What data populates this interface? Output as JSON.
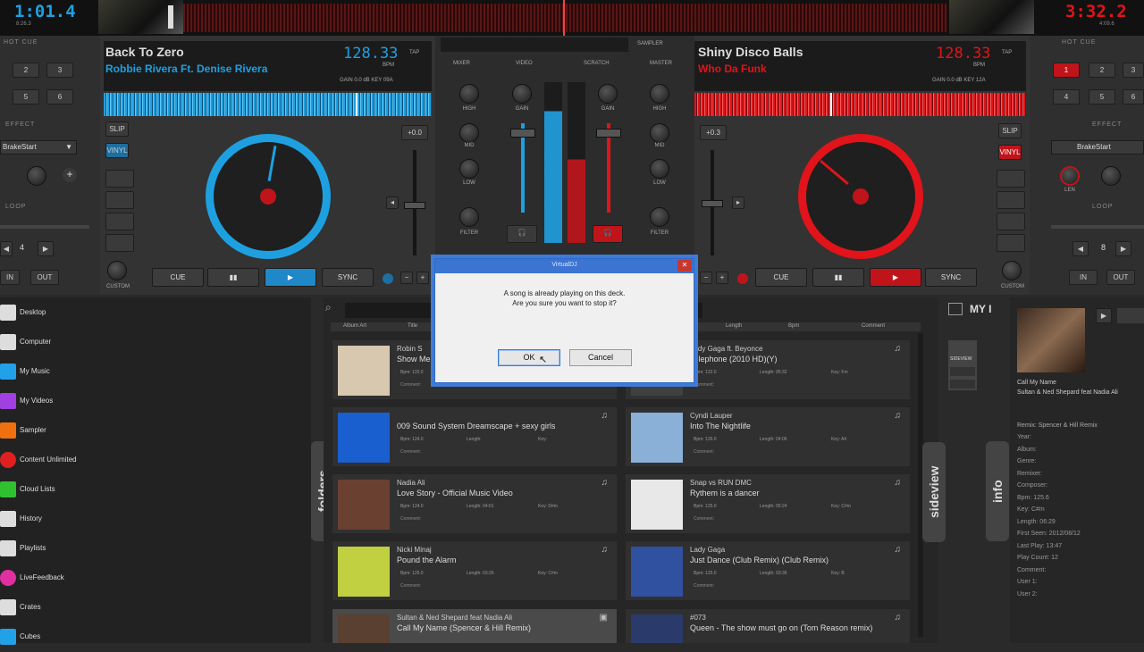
{
  "top": {
    "left_time": "1:01.4",
    "left_sub": "8:26.3",
    "right_time": "3:32.2",
    "right_sub": "4:09.6"
  },
  "left_panel": {
    "hot_cue_label": "HOT CUE",
    "hot_cues": [
      "2",
      "3",
      "5",
      "6"
    ],
    "effect_label": "EFFECT",
    "effect_name": "BrakeStart",
    "loop_label": "LOOP",
    "loop_value": "4",
    "in_label": "IN",
    "out_label": "OUT",
    "custom_label": "CUSTOM"
  },
  "right_panel": {
    "hot_cue_label": "HOT CUE",
    "hot_cues": [
      "1",
      "2",
      "3",
      "4",
      "5",
      "6"
    ],
    "effect_label": "EFFECT",
    "effect_name": "BrakeStart",
    "len_label": "LEN",
    "loop_label": "LOOP",
    "loop_value": "8",
    "in_label": "IN",
    "out_label": "OUT",
    "custom_label": "CUSTOM"
  },
  "deck_left": {
    "title": "Back To Zero",
    "artist": "Robbie Rivera Ft. Denise Rivera",
    "bpm": "128.33",
    "bpm_unit": "BPM",
    "tap": "TAP",
    "gain_row": "GAIN  0.0 dB  KEY  09A",
    "slip": "SLIP",
    "vinyl": "VINYL",
    "pitch": "+0.0",
    "cue": "CUE",
    "sync": "SYNC",
    "accent": "#1ea0e0"
  },
  "deck_right": {
    "title": "Shiny Disco Balls",
    "artist": "Who Da Funk",
    "bpm": "128.33",
    "bpm_unit": "BPM",
    "tap": "TAP",
    "gain_row": "GAIN  0.0 dB  KEY  12A",
    "slip": "SLIP",
    "vinyl": "VINYL",
    "pitch": "+0.3",
    "cue": "CUE",
    "sync": "SYNC",
    "accent": "#e0141a"
  },
  "mixer": {
    "tabs": [
      "MIXER",
      "VIDEO",
      "SCRATCH",
      "MASTER"
    ],
    "sampler": "SAMPLER",
    "high": "HIGH",
    "mid": "MID",
    "low": "LOW",
    "filter": "FILTER",
    "gain": "GAIN"
  },
  "folders": [
    {
      "label": "Desktop",
      "color": "#dddddd"
    },
    {
      "label": "Computer",
      "color": "#dddddd"
    },
    {
      "label": "My Music",
      "color": "#22a0e8"
    },
    {
      "label": "My Videos",
      "color": "#a040e0"
    },
    {
      "label": "Sampler",
      "color": "#f07010"
    },
    {
      "label": "Content Unlimited",
      "color": "#e02020"
    },
    {
      "label": "Cloud Lists",
      "color": "#30c030"
    },
    {
      "label": "History",
      "color": "#dddddd"
    },
    {
      "label": "Playlists",
      "color": "#dddddd"
    },
    {
      "label": "LiveFeedback",
      "color": "#e030a0"
    },
    {
      "label": "Crates",
      "color": "#dddddd"
    },
    {
      "label": "Cubes",
      "color": "#22a0e8"
    }
  ],
  "browser": {
    "columns_left": [
      "Album Art",
      "Title"
    ],
    "columns_right": [
      "Length",
      "Bpm",
      "Comment"
    ],
    "folders_tab": "folders",
    "sideview_tab": "sideview",
    "info_tab": "info",
    "my_label": "MY I",
    "sideview_btn": "SIDEVIEW",
    "tracks_left": [
      {
        "artist": "Robin S",
        "title": "Show Me Love",
        "bpm": "Bpm: 120.0",
        "length": "",
        "key": "",
        "color": "#d8c8b0"
      },
      {
        "artist": "009 Sound System Dreamscape + sexy girls",
        "title": "",
        "bpm": "Bpm: 124.0",
        "length": "Length:",
        "key": "Key:",
        "color": "#1a5fd0"
      },
      {
        "artist": "Nadia Ali",
        "title": "Love Story - Official Music Video",
        "bpm": "Bpm: 124.0",
        "length": "Length: 04:01",
        "key": "Key: D#m",
        "color": "#6a4030"
      },
      {
        "artist": "Nicki Minaj",
        "title": "Pound the Alarm",
        "bpm": "Bpm: 125.0",
        "length": "Length: 03:26",
        "key": "Key: C#m",
        "color": "#c0d040"
      },
      {
        "artist": "Sultan & Ned Shepard feat Nadia Ali",
        "title": "Call My Name (Spencer & Hill Remix)",
        "bpm": "",
        "length": "",
        "key": "",
        "color": "#5a4030"
      }
    ],
    "tracks_right": [
      {
        "artist": "Lady Gaga ft. Beyonce",
        "title": "Telephone (2010 HD)(Y)",
        "bpm": "Bpm: 122.0",
        "length": "Length: 05:32",
        "key": "Key: Fm",
        "color": "#404040"
      },
      {
        "artist": "Cyndi Lauper",
        "title": "Into The Nightlife",
        "bpm": "Bpm: 126.0",
        "length": "Length: 04:06",
        "key": "Key: A#",
        "color": "#8ab0d8"
      },
      {
        "artist": "Snap vs RUN DMC",
        "title": "Rythem is a dancer",
        "bpm": "Bpm: 125.0",
        "length": "Length: 05:24",
        "key": "Key: C#m",
        "color": "#e8e8e8"
      },
      {
        "artist": "Lady Gaga",
        "title": "Just Dance (Club Remix) (Club Remix)",
        "bpm": "Bpm: 125.0",
        "length": "Length: 03:36",
        "key": "Key: B",
        "color": "#3050a0"
      },
      {
        "artist": "#073",
        "title": "Queen - The show must go on (Tom Reason remix)",
        "bpm": "",
        "length": "",
        "key": "",
        "color": "#2a3a6a"
      }
    ],
    "comment": "Comment:"
  },
  "info": {
    "name": "Call My Name",
    "artist": "Sultan & Ned Shepard feat Nadia Ali",
    "remix": "Remix: Spencer & Hill Remix",
    "fields": [
      "Year:",
      "Album:",
      "Genre:",
      "Remixer:",
      "Composer:",
      "Bpm: 125.6",
      "Key: C#m",
      "Length: 06:29",
      "First Seen: 2012/08/12",
      "Last Play: 13:47",
      "Play Count: 12",
      "Comment:",
      "User 1:",
      "User 2:"
    ]
  },
  "dialog": {
    "title": "VirtualDJ",
    "line1": "A song is already playing on this deck.",
    "line2": "Are you sure you want to stop it?",
    "ok": "OK",
    "cancel": "Cancel",
    "close": "✕"
  }
}
